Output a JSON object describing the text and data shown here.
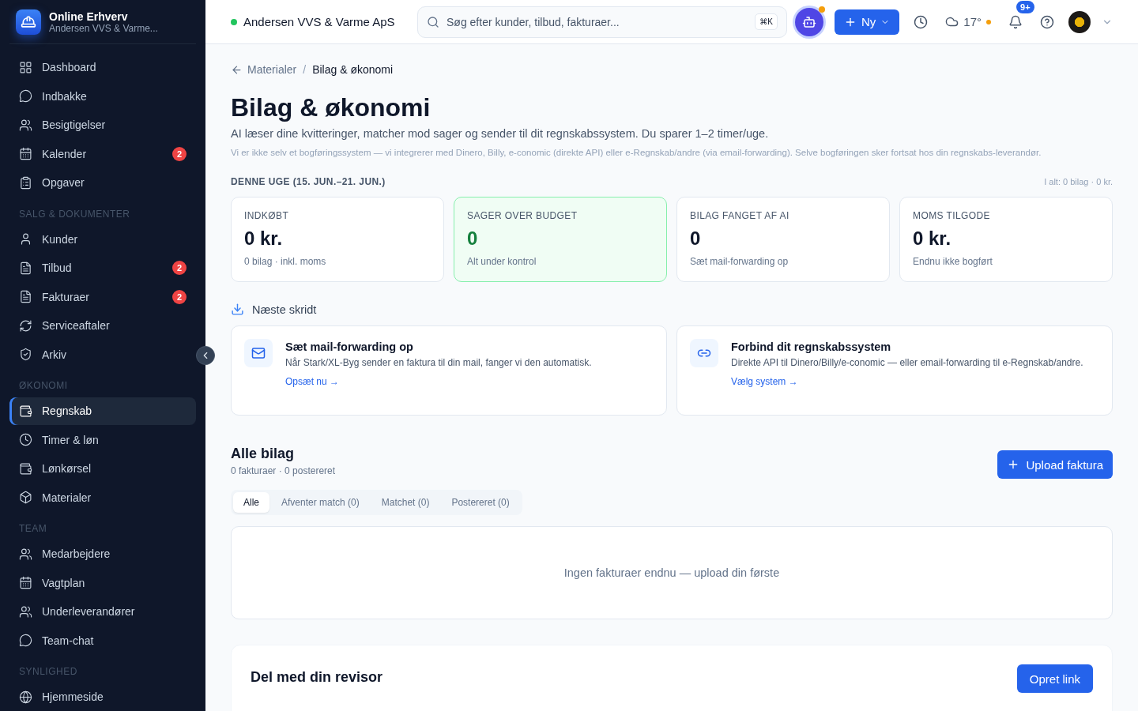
{
  "sidebar": {
    "brand": {
      "title": "Online Erhverv",
      "subtitle": "Andersen VVS & Varme..."
    },
    "sections": [
      {
        "items": [
          {
            "label": "Dashboard",
            "selected": false
          },
          {
            "label": "Indbakke",
            "selected": false
          },
          {
            "label": "Besigtigelser",
            "selected": false
          },
          {
            "label": "Kalender",
            "selected": false,
            "badge": "2"
          },
          {
            "label": "Opgaver",
            "selected": false
          }
        ]
      },
      {
        "heading": "SALG & DOKUMENTER",
        "items": [
          {
            "label": "Kunder",
            "selected": false
          },
          {
            "label": "Tilbud",
            "selected": false,
            "badge": "2"
          },
          {
            "label": "Fakturaer",
            "selected": false,
            "badge": "2"
          },
          {
            "label": "Serviceaftaler",
            "selected": false
          },
          {
            "label": "Arkiv",
            "selected": false
          }
        ]
      },
      {
        "heading": "ØKONOMI",
        "items": [
          {
            "label": "Regnskab",
            "selected": true
          },
          {
            "label": "Timer & løn",
            "selected": false
          },
          {
            "label": "Lønkørsel",
            "selected": false
          },
          {
            "label": "Materialer",
            "selected": false
          }
        ]
      },
      {
        "heading": "TEAM",
        "items": [
          {
            "label": "Medarbejdere",
            "selected": false
          },
          {
            "label": "Vagtplan",
            "selected": false
          },
          {
            "label": "Underleverandører",
            "selected": false
          },
          {
            "label": "Team-chat",
            "selected": false
          }
        ]
      },
      {
        "heading": "SYNLIGHED",
        "items": [
          {
            "label": "Hjemmeside",
            "selected": false
          }
        ]
      }
    ]
  },
  "topbar": {
    "company": {
      "name": "Andersen VVS & Varme ApS",
      "color": "#22c55e"
    },
    "search": {
      "placeholder": "Søg efter kunder, tilbud, fakturaer...",
      "shortcut": "⌘K"
    },
    "new_button": "Ny",
    "weather": "17°",
    "notifications": "9+"
  },
  "breadcrumb": {
    "parent": "Materialer",
    "separator": "/",
    "current": "Bilag & økonomi"
  },
  "title": "Bilag & økonomi",
  "subtitle": "AI læser dine kvitteringer, matcher mod sager og sender til dit regnskabssystem. Du sparer 1–2 timer/uge.",
  "note": "Vi er ikke selv et bogføringssystem — vi integrerer med Dinero, Billy, e-conomic (direkte API) eller e-Regnskab/andre (via email-forwarding). Selve bogføringen sker fortsat hos din regnskabs-leverandør.",
  "week": {
    "heading": "DENNE UGE (15. JUN.–21. JUN.)",
    "total": "I alt: 0 bilag · 0 kr."
  },
  "stats": [
    {
      "label": "INDKØBT",
      "value": "0 kr.",
      "caption": "0 bilag · inkl. moms",
      "highlighted": false
    },
    {
      "label": "SAGER OVER BUDGET",
      "value": "0",
      "caption": "Alt under kontrol",
      "highlighted": true
    },
    {
      "label": "BILAG FANGET AF AI",
      "value": "0",
      "caption": "Sæt mail-forwarding op",
      "highlighted": false
    },
    {
      "label": "MOMS TILGODE",
      "value": "0 kr.",
      "caption": "Endnu ikke bogført",
      "highlighted": false
    }
  ],
  "next_steps": {
    "heading": "Næste skridt",
    "cards": [
      {
        "title": "Sæt mail-forwarding op",
        "text": "Når Stark/XL-Byg sender en faktura til din mail, fanger vi den automatisk.",
        "link": "Opsæt nu →"
      },
      {
        "title": "Forbind dit regnskabssystem",
        "text": "Direkte API til Dinero/Billy/e-conomic — eller email-forwarding til e-Regnskab/andre.",
        "link": "Vælg system →"
      }
    ]
  },
  "documents": {
    "title": "Alle bilag",
    "summary": "0 fakturaer · 0 postereret",
    "upload_button": "Upload faktura",
    "tabs": [
      {
        "label": "Alle",
        "selected": true
      },
      {
        "label": "Afventer match (0)",
        "selected": false
      },
      {
        "label": "Matchet (0)",
        "selected": false
      },
      {
        "label": "Postereret (0)",
        "selected": false
      }
    ],
    "empty": "Ingen fakturaer endnu — upload din første"
  },
  "share": {
    "title": "Del med din revisor",
    "button": "Opret link"
  }
}
